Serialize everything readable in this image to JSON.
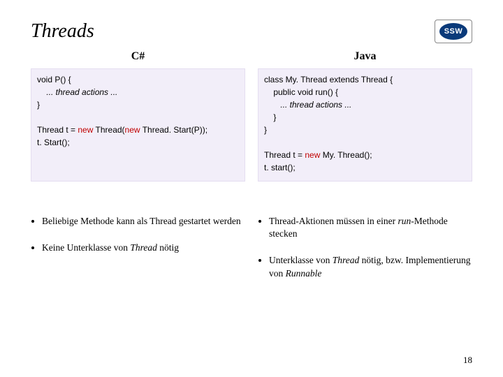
{
  "header": {
    "title": "Threads",
    "logo_text": "SSW"
  },
  "left": {
    "heading": "C#",
    "code": {
      "line1": "void P() {",
      "line2": "    ... thread actions ...",
      "line3": "}",
      "line4": "",
      "line5a": "Thread t = ",
      "line5_new": "new ",
      "line5b": "Thread(",
      "line5_new2": "new ",
      "line5c": "Thread. Start(P));",
      "line6": "t. Start();"
    },
    "bullets": [
      {
        "pre": "Beliebige Methode kann als Thread gestartet werden",
        "i": ""
      },
      {
        "pre": "Keine Unterklasse von ",
        "i": "Thread",
        "post": " nötig"
      }
    ]
  },
  "right": {
    "heading": "Java",
    "code": {
      "line1": "class My. Thread extends Thread {",
      "line2": "    public void run() {",
      "line3": "       ... thread actions ...",
      "line4": "    }",
      "line5": "}",
      "line6": "",
      "line7a": "Thread t = ",
      "line7_new": "new ",
      "line7b": "My. Thread();",
      "line8": "t. start();"
    },
    "bullets": [
      {
        "pre": "Thread-Aktionen müssen in einer ",
        "i": "run",
        "post": "-Methode stecken"
      },
      {
        "pre": "Unterklasse von ",
        "i": "Thread",
        "post": " nötig, bzw. Implementierung von ",
        "i2": "Runnable"
      }
    ]
  },
  "page_number": "18"
}
